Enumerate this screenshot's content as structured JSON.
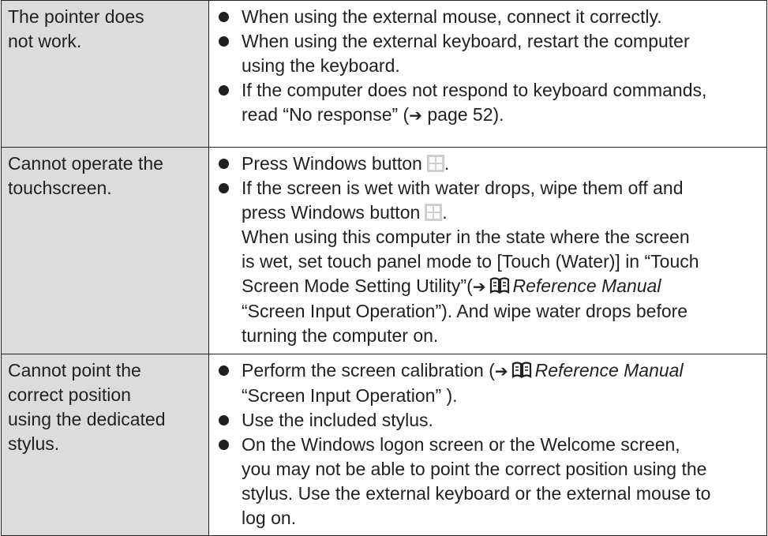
{
  "rows": [
    {
      "problem": [
        "The pointer does",
        "not work."
      ],
      "items": [
        {
          "lines": [
            "When using the external mouse, connect it correctly."
          ]
        },
        {
          "lines": [
            "When using the external keyboard, restart the computer",
            "using the keyboard."
          ]
        },
        {
          "lines": [
            "If the computer does not respond to keyboard commands,"
          ],
          "l2_pre": "read “No response” (",
          "l2_arrow": "➔",
          "l2_post": " page 52)."
        }
      ]
    },
    {
      "problem": [
        "Cannot operate the",
        "touchscreen."
      ],
      "i1_text": "Press Windows button",
      "i2_line1": "If the screen is wet with water drops, wipe them off and",
      "i2_line2": "press Windows button",
      "i2_line3": "When using this computer in the state where the screen",
      "i2_line4": "is wet, set touch panel mode to [Touch (Water)] in “Touch",
      "i2_line5_pre": "Screen Mode Setting Utility”(",
      "i2_line5_arrow": "➔",
      "i2_line5_ref": "Reference Manual",
      "i2_line6": "“Screen Input Operation”). And wipe water drops before",
      "i2_line7": "turning the computer on."
    },
    {
      "problem": [
        "Cannot point the",
        "correct position",
        "using the dedicated",
        "stylus."
      ],
      "i1_pre": "Perform the screen calibration (",
      "i1_arrow": "➔",
      "i1_ref": "Reference Manual",
      "i1_line2": "“Screen Input Operation” ).",
      "i2_text": "Use the included stylus.",
      "i3_lines": [
        "On the Windows logon screen or the Welcome screen,",
        "you may not be able to point the correct position using the",
        "stylus. Use the external keyboard or the external mouse to",
        "log on."
      ]
    }
  ],
  "icons": {
    "windows": "windows-logo-icon",
    "manual": "reference-manual-book-icon",
    "bullet": "bullet-icon"
  }
}
